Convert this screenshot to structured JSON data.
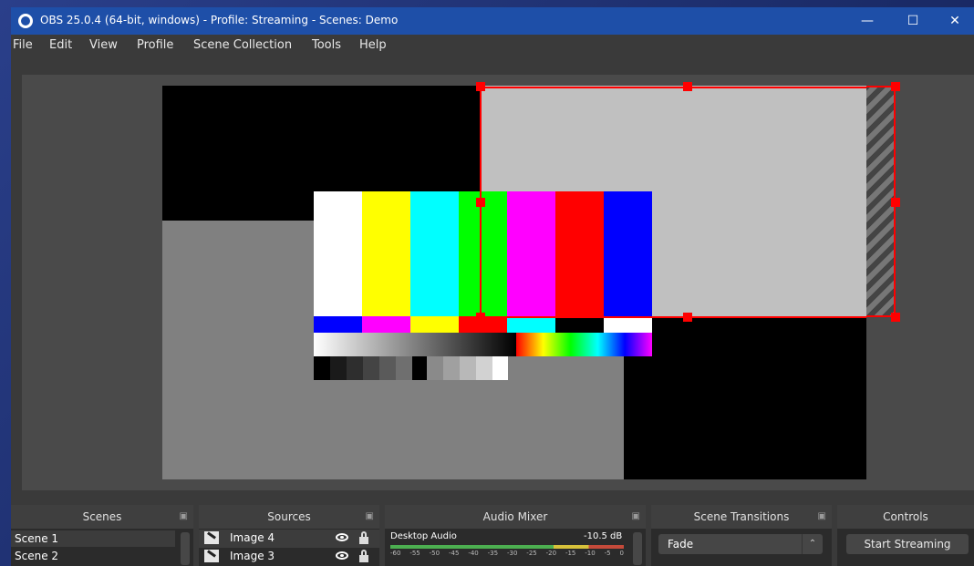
{
  "window": {
    "title": "OBS 25.0.4 (64-bit, windows) - Profile: Streaming - Scenes: Demo",
    "controls": {
      "minimize": "—",
      "maximize": "☐",
      "close": "✕"
    }
  },
  "menu": [
    "File",
    "Edit",
    "View",
    "Profile",
    "Scene Collection",
    "Tools",
    "Help"
  ],
  "docks": {
    "scenes": {
      "title": "Scenes",
      "items": [
        "Scene 1",
        "Scene 2"
      ]
    },
    "sources": {
      "title": "Sources",
      "items": [
        "Image 4",
        "Image 3"
      ]
    },
    "audio_mixer": {
      "title": "Audio Mixer",
      "channel": "Desktop Audio",
      "level": "-10.5 dB",
      "ticks": [
        "-60",
        "-55",
        "-50",
        "-45",
        "-40",
        "-35",
        "-30",
        "-25",
        "-20",
        "-15",
        "-10",
        "-5",
        "0"
      ]
    },
    "scene_transitions": {
      "title": "Scene Transitions",
      "selected": "Fade"
    },
    "controls": {
      "title": "Controls",
      "start_streaming": "Start Streaming"
    }
  },
  "colors": {
    "titlebar": "#1e4fa8",
    "selection": "#ff0000",
    "window_bg": "#3a3a3a"
  }
}
